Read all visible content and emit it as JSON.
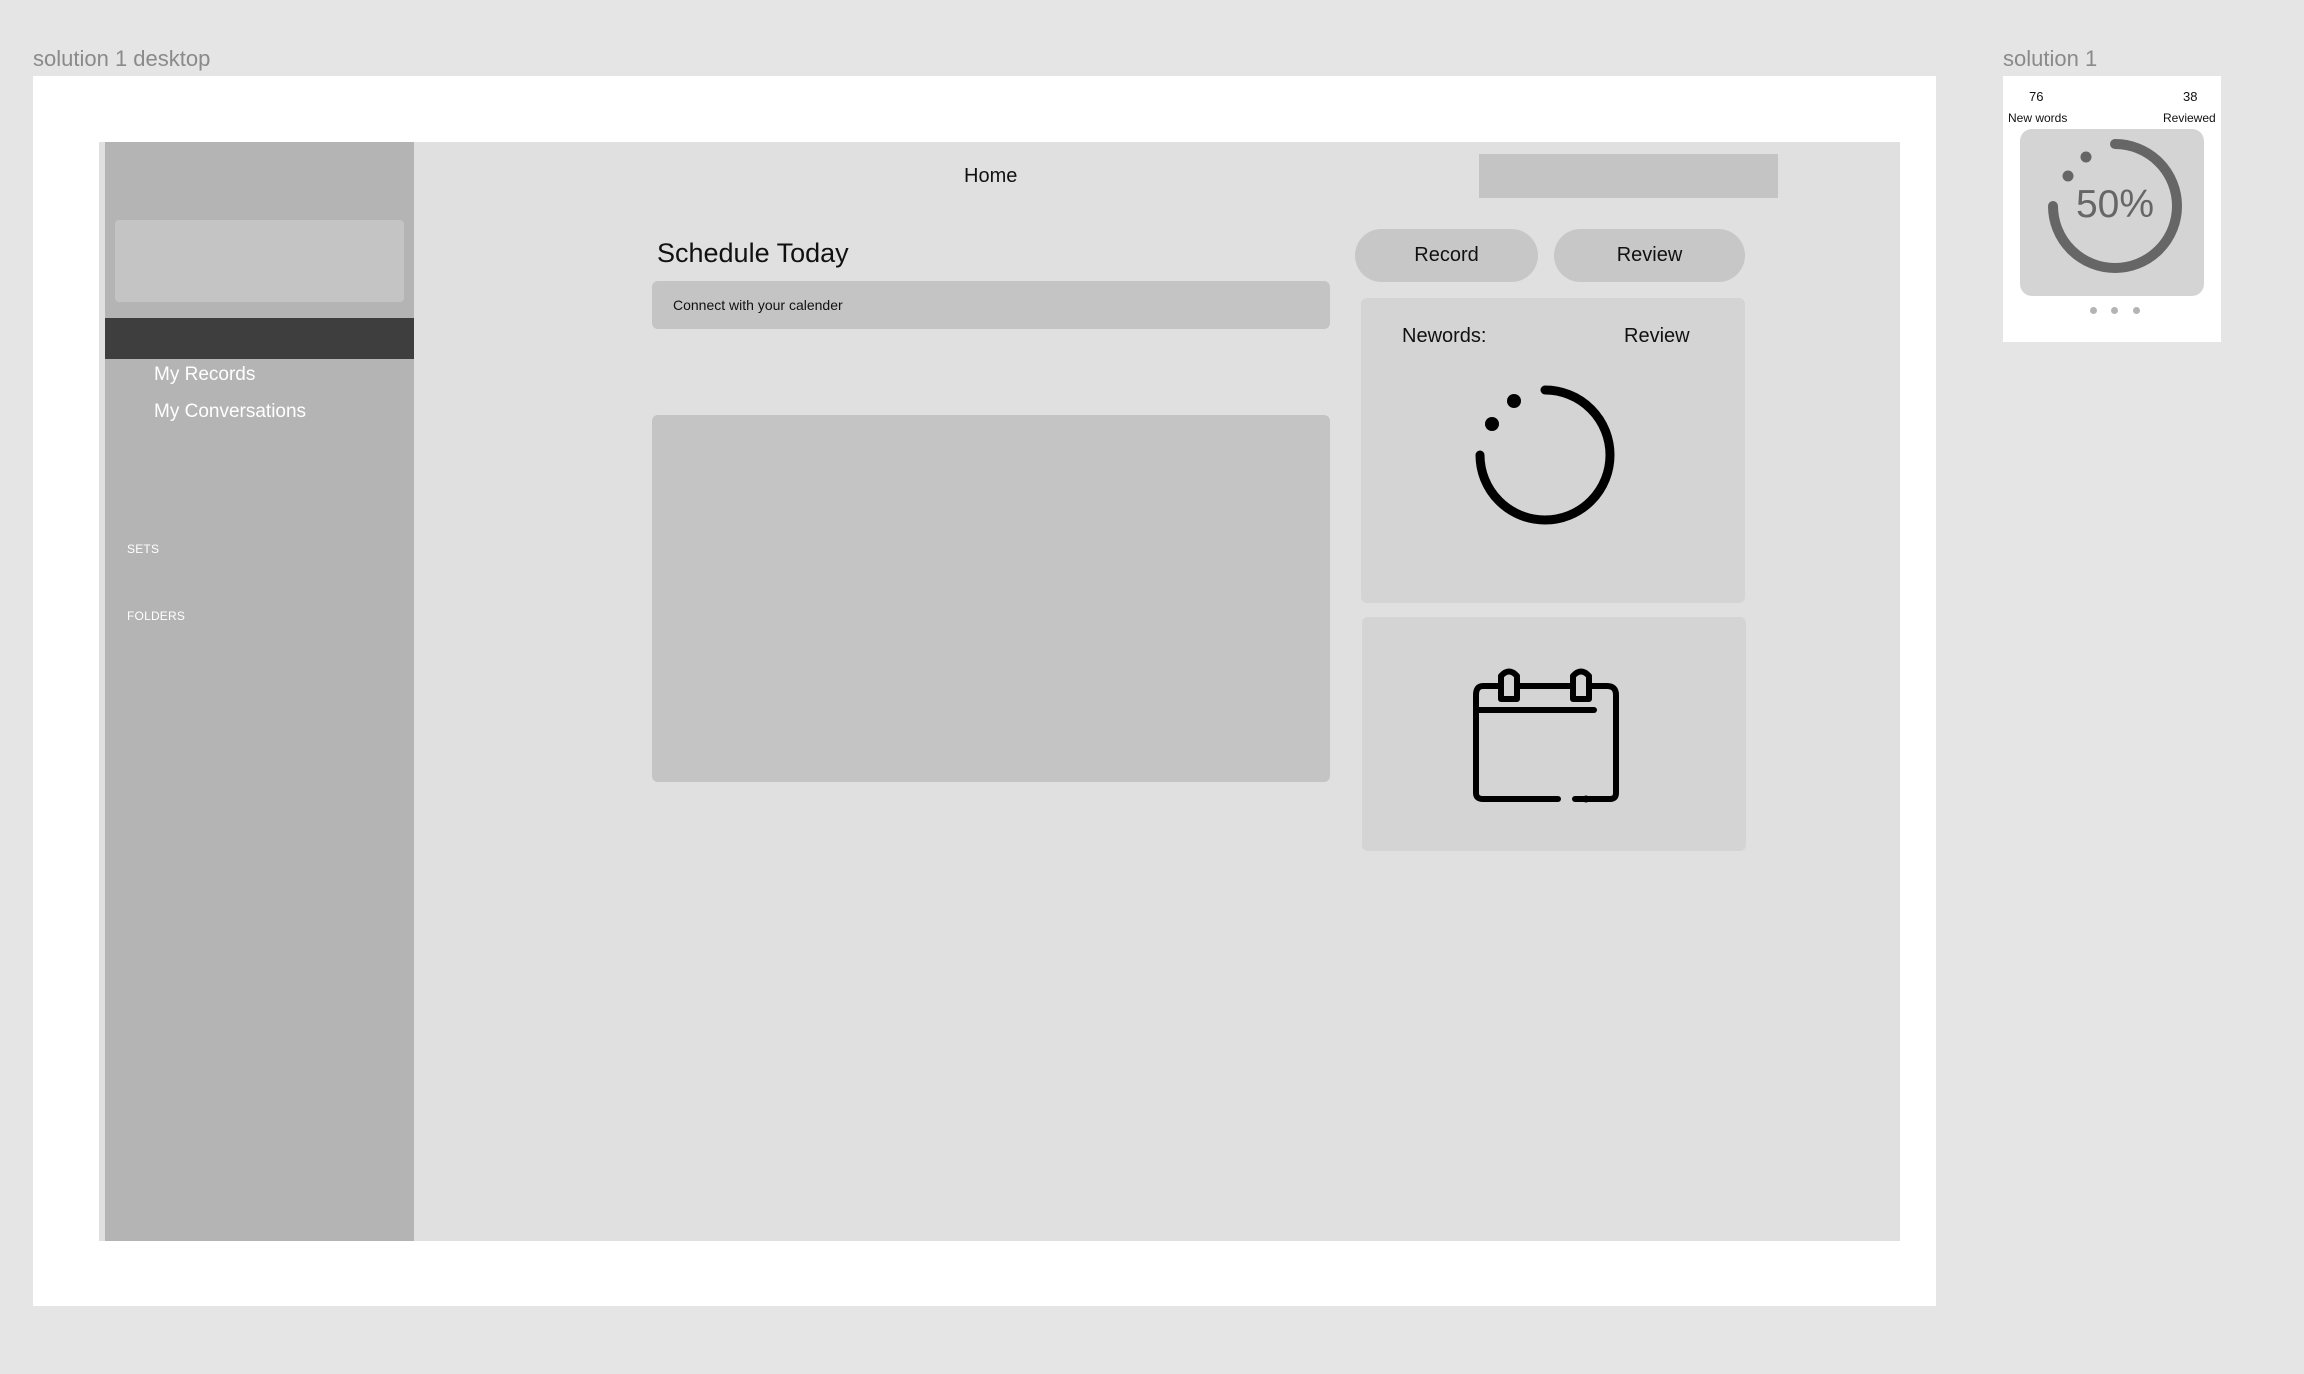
{
  "desktop_frame": {
    "label": "solution 1 desktop"
  },
  "mobile_frame": {
    "label": "solution 1"
  },
  "sidebar": {
    "items": [
      {
        "label": "My Records"
      },
      {
        "label": "My Conversations"
      }
    ],
    "sections": [
      {
        "label": "SETS"
      },
      {
        "label": "FOLDERS"
      }
    ]
  },
  "header": {
    "title": "Home"
  },
  "schedule": {
    "title": "Schedule Today",
    "connect_label": "Connect with your calender"
  },
  "actions": {
    "record_label": "Record",
    "review_label": "Review"
  },
  "progress_card": {
    "left_label": "Newords:",
    "right_label": "Review",
    "icon": "loading-ring-icon"
  },
  "calendar_card": {
    "icon": "calendar-icon"
  },
  "mobile": {
    "new_words_count": "76",
    "new_words_label": "New words",
    "reviewed_count": "38",
    "reviewed_label": "Reviewed",
    "progress_percent": "50%",
    "progress_fraction": 0.5,
    "page_dots": 3
  },
  "colors": {
    "canvas": "#e5e5e5",
    "frame": "#ffffff",
    "app_bg": "#e0e0e0",
    "sidebar": "#b4b4b4",
    "sidebar_active": "#3e3e3e",
    "placeholder": "#c4c4c4",
    "card": "#d4d4d4",
    "ring_mobile": "#666666",
    "ring_desktop": "#000000"
  }
}
